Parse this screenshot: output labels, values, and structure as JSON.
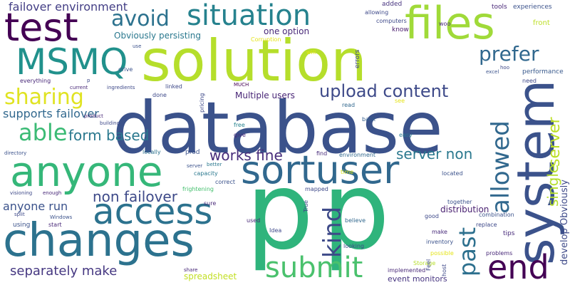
{
  "words": [
    {
      "text": "solution",
      "color": "#b5de2b"
    },
    {
      "text": "database",
      "color": "#3b528b"
    },
    {
      "text": "p",
      "color": "#2fb47c"
    },
    {
      "text": "p",
      "color": "#2fb47c"
    },
    {
      "text": "changes",
      "color": "#2c728e"
    },
    {
      "text": "anyone",
      "color": "#35b779"
    },
    {
      "text": "sortuser",
      "color": "#31688e"
    },
    {
      "text": "access",
      "color": "#2c728e"
    },
    {
      "text": "system",
      "color": "#3b528b"
    },
    {
      "text": "files",
      "color": "#a0da39"
    },
    {
      "text": "test",
      "color": "#440154"
    },
    {
      "text": "MSMQ",
      "color": "#21918c"
    },
    {
      "text": "situation",
      "color": "#26828e"
    },
    {
      "text": "end",
      "color": "#440154"
    },
    {
      "text": "submit",
      "color": "#4ac16d"
    },
    {
      "text": "allowed",
      "color": "#31688e"
    },
    {
      "text": "past",
      "color": "#2d708e"
    },
    {
      "text": "kind",
      "color": "#3e4a89"
    },
    {
      "text": "prefer",
      "color": "#31688e"
    },
    {
      "text": "avoid",
      "color": "#2c728e"
    },
    {
      "text": "sharing",
      "color": "#e0e322"
    },
    {
      "text": "able",
      "color": "#3bbb75"
    },
    {
      "text": "upload content",
      "color": "#3e4a89"
    },
    {
      "text": "server",
      "color": "#bddf26"
    },
    {
      "text": "single",
      "color": "#b5de2b"
    },
    {
      "text": "failover environment",
      "color": "#433e85"
    },
    {
      "text": "form based",
      "color": "#2a788e"
    },
    {
      "text": "works fine",
      "color": "#472d7b"
    },
    {
      "text": "server non",
      "color": "#2a788e"
    },
    {
      "text": "non failover",
      "color": "#3e4a89"
    },
    {
      "text": "anyone run",
      "color": "#3b528b"
    },
    {
      "text": "separately make",
      "color": "#453781"
    },
    {
      "text": "supports failover",
      "color": "#31688e"
    },
    {
      "text": "Obviously persisting",
      "color": "#2a788e"
    },
    {
      "text": "one option",
      "color": "#482878"
    },
    {
      "text": "develop Obviously",
      "color": "#3e4a89"
    },
    {
      "text": "Multiple users",
      "color": "#482576"
    },
    {
      "text": "distribution",
      "color": "#481f70"
    },
    {
      "text": "event monitors",
      "color": "#463480"
    },
    {
      "text": "spreadsheet",
      "color": "#c2df23"
    },
    {
      "text": "experiences",
      "color": "#3b528b"
    },
    {
      "text": "performance",
      "color": "#38598c"
    },
    {
      "text": "tools",
      "color": "#482677"
    },
    {
      "text": "front",
      "color": "#bddf26"
    },
    {
      "text": "errors",
      "color": "#3e4989"
    },
    {
      "text": "computers",
      "color": "#3e4989"
    },
    {
      "text": "allowing",
      "color": "#3e4989"
    },
    {
      "text": "added",
      "color": "#46327e"
    },
    {
      "text": "know",
      "color": "#481a6c"
    },
    {
      "text": "woo",
      "color": "#482878"
    },
    {
      "text": "Corruption",
      "color": "#e5e419"
    },
    {
      "text": "will",
      "color": "#e5e419"
    },
    {
      "text": "looking",
      "color": "#3e4989"
    },
    {
      "text": "read",
      "color": "#31688e"
    },
    {
      "text": "see",
      "color": "#e5e419"
    },
    {
      "text": "back",
      "color": "#355f8d"
    },
    {
      "text": "easy",
      "color": "#2a788e"
    },
    {
      "text": "give",
      "color": "#472a7a"
    },
    {
      "text": "free",
      "color": "#26828e"
    },
    {
      "text": "MUCH",
      "color": "#440154"
    },
    {
      "text": "pricing",
      "color": "#3e4989"
    },
    {
      "text": "linked",
      "color": "#3e4989"
    },
    {
      "text": "done",
      "color": "#3e4989"
    },
    {
      "text": "prod",
      "color": "#3b528b"
    },
    {
      "text": "locally",
      "color": "#2c728e"
    },
    {
      "text": "find",
      "color": "#472a7a"
    },
    {
      "text": "environment",
      "color": "#31688e"
    },
    {
      "text": "time",
      "color": "#d8e219"
    },
    {
      "text": "located",
      "color": "#3b528b"
    },
    {
      "text": "capacity",
      "color": "#2a788e"
    },
    {
      "text": "better",
      "color": "#2a788e"
    },
    {
      "text": "server",
      "color": "#3b528b"
    },
    {
      "text": "correct",
      "color": "#3b528b"
    },
    {
      "text": "frightening",
      "color": "#46c06f"
    },
    {
      "text": "mapped",
      "color": "#3e4989"
    },
    {
      "text": "True",
      "color": "#3e4989"
    },
    {
      "text": "sure",
      "color": "#482878"
    },
    {
      "text": "used",
      "color": "#482878"
    },
    {
      "text": "Idea",
      "color": "#3e4989"
    },
    {
      "text": "believe",
      "color": "#31688e"
    },
    {
      "text": "together",
      "color": "#3b528b"
    },
    {
      "text": "combination",
      "color": "#3b528b"
    },
    {
      "text": "replace",
      "color": "#3e4989"
    },
    {
      "text": "tips",
      "color": "#472a7a"
    },
    {
      "text": "good",
      "color": "#3e4989"
    },
    {
      "text": "make",
      "color": "#472a7a"
    },
    {
      "text": "inventory",
      "color": "#3b528b"
    },
    {
      "text": "possible",
      "color": "#e5e419"
    },
    {
      "text": "problems",
      "color": "#482878"
    },
    {
      "text": "implemented",
      "color": "#482878"
    },
    {
      "text": "Storage",
      "color": "#b5de2b"
    },
    {
      "text": "host",
      "color": "#3e4989"
    },
    {
      "text": "Feel",
      "color": "#3e4989"
    },
    {
      "text": "everything",
      "color": "#482878"
    },
    {
      "text": "use",
      "color": "#3b528b"
    },
    {
      "text": "p",
      "color": "#3e4989"
    },
    {
      "text": "current",
      "color": "#482878"
    },
    {
      "text": "ingredients",
      "color": "#3e4989"
    },
    {
      "text": "drive",
      "color": "#3b528b"
    },
    {
      "text": "product",
      "color": "#482878"
    },
    {
      "text": "building",
      "color": "#3e4989"
    },
    {
      "text": "directory",
      "color": "#3b528b"
    },
    {
      "text": "visioning",
      "color": "#3e4989"
    },
    {
      "text": "enough",
      "color": "#482878"
    },
    {
      "text": "split",
      "color": "#3e4989"
    },
    {
      "text": "Windows",
      "color": "#3b528b"
    },
    {
      "text": "start",
      "color": "#482878"
    },
    {
      "text": "using",
      "color": "#3b528b"
    },
    {
      "text": "share",
      "color": "#482878"
    },
    {
      "text": "excel",
      "color": "#3b528b"
    },
    {
      "text": "hoo",
      "color": "#3e4989"
    },
    {
      "text": "need",
      "color": "#3e4989"
    }
  ]
}
